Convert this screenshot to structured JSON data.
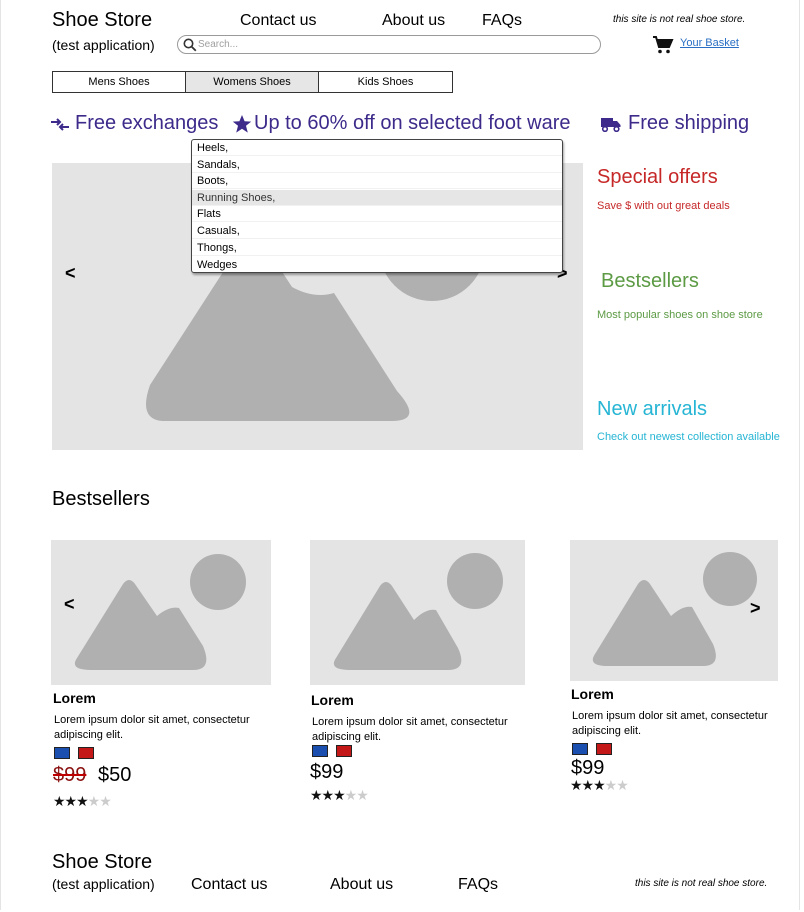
{
  "header": {
    "brand": "Shoe Store",
    "subtitle": "(test application)",
    "nav": [
      "Contact us",
      "About us",
      "FAQs"
    ],
    "note": "this site is not real shoe store.",
    "search_placeholder": "Search...",
    "basket_label": "Your Basket"
  },
  "categories": [
    {
      "label": "Mens Shoes",
      "active": false
    },
    {
      "label": "Womens Shoes",
      "active": true
    },
    {
      "label": "Kids Shoes",
      "active": false
    }
  ],
  "promos": [
    "Free exchanges",
    "Up to 60% off on selected foot ware",
    "Free shipping"
  ],
  "dropdown": {
    "items": [
      "Heels,",
      "Sandals,",
      "Boots,",
      "Running Shoes,",
      "Flats",
      "Casuals,",
      "Thongs,",
      "Wedges"
    ],
    "highlighted": "Running Shoes,"
  },
  "carousel": {
    "prev": "<",
    "next": ">"
  },
  "side_panels": [
    {
      "title": "Special offers",
      "text": "Save $ with out great deals",
      "color": "#c62828"
    },
    {
      "title": "Bestsellers",
      "text": "Most popular shoes on shoe store",
      "color": "#5c9a44"
    },
    {
      "title": "New arrivals",
      "text": "Check out newest collection available",
      "color": "#26b5d4"
    }
  ],
  "bestsellers": {
    "title": "Bestsellers",
    "prev": "<",
    "next": ">",
    "products": [
      {
        "name": "Lorem",
        "desc": "Lorem ipsum dolor sit amet, consectetur adipiscing elit.",
        "old_price": "$99",
        "price": "$50",
        "rating": 3,
        "max_rating": 5
      },
      {
        "name": "Lorem",
        "desc": "Lorem ipsum dolor sit amet, consectetur adipiscing elit.",
        "price": "$99",
        "rating": 3,
        "max_rating": 5
      },
      {
        "name": "Lorem",
        "desc": "Lorem ipsum dolor sit amet, consectetur adipiscing elit.",
        "price": "$99",
        "rating": 3,
        "max_rating": 5
      }
    ],
    "swatch_colors": [
      "#1a4fb0",
      "#c41818"
    ]
  },
  "footer": {
    "brand": "Shoe Store",
    "subtitle": "(test application)",
    "nav": [
      "Contact us",
      "About us",
      "FAQs"
    ],
    "note": "this site is not real shoe store."
  }
}
